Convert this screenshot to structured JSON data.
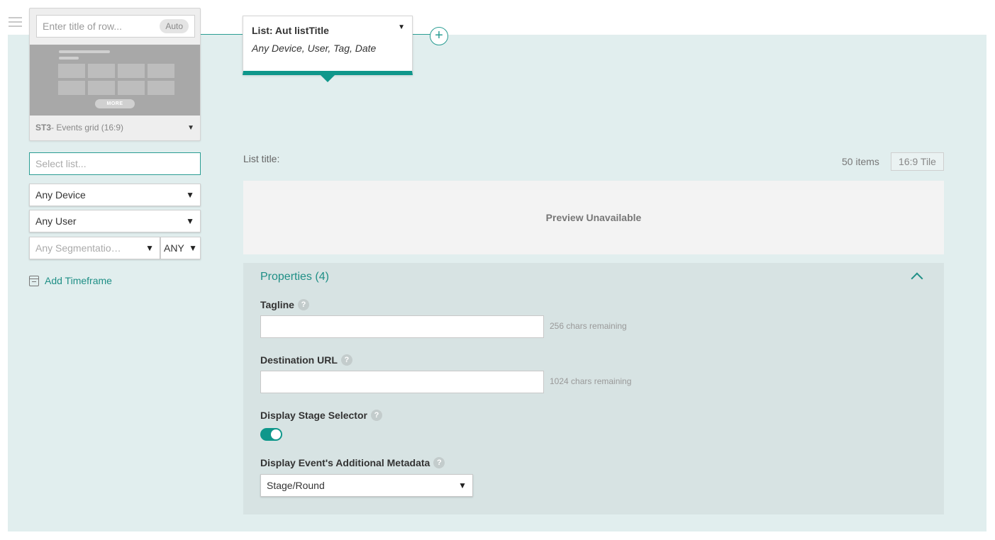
{
  "colors": {
    "accent": "#0f978b",
    "canvas_bg": "#e1eeee",
    "panel_bg": "#d7e3e3"
  },
  "row": {
    "title_placeholder": "Enter title of row...",
    "auto_label": "Auto",
    "thumb_more_label": "MORE",
    "template_code": "ST3",
    "template_name": " - Events grid (16:9)"
  },
  "left_controls": {
    "select_list_placeholder": "Select list...",
    "device": "Any Device",
    "user": "Any User",
    "segmentation_placeholder": "Any Segmentatio…",
    "segmentation_mode": "ANY",
    "add_timeframe_label": "Add Timeframe"
  },
  "list_card": {
    "title": "List: Aut listTitle",
    "subtitle": "Any Device, User, Tag, Date"
  },
  "main": {
    "list_title_label": "List title:",
    "items_count": "50 items",
    "tile_format": "16:9 Tile",
    "preview_text": "Preview Unavailable"
  },
  "properties": {
    "header": "Properties (4)",
    "tagline_label": "Tagline",
    "tagline_value": "",
    "tagline_remaining": "256 chars remaining",
    "url_label": "Destination URL",
    "url_value": "",
    "url_remaining": "1024 chars remaining",
    "stage_selector_label": "Display Stage Selector",
    "stage_selector_on": true,
    "metadata_label": "Display Event's Additional Metadata",
    "metadata_value": "Stage/Round",
    "help_glyph": "?"
  },
  "icons": {
    "caret": "▼",
    "plus": "+"
  }
}
